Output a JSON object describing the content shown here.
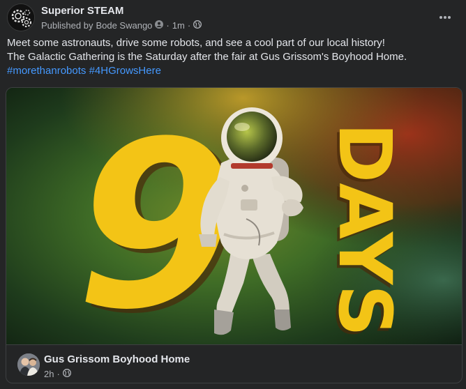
{
  "post": {
    "page_name": "Superior STEAM",
    "published_by_prefix": "Published by",
    "author": "Bode Swango",
    "time": "1m",
    "separator": "·",
    "audience_icon": "globe-icon",
    "more_icon": "more-horizontal-icon",
    "text": {
      "line1": "Meet some astronauts, drive some robots, and see a cool part of our local history!",
      "line2": "The Galactic Gathering is the Saturday after the fair at Gus Grissom's Boyhood Home.",
      "hashtags": [
        "#morethanrobots",
        "#4HGrowsHere"
      ]
    }
  },
  "graphic": {
    "number": "9",
    "word": "DAYS"
  },
  "shared": {
    "page_name": "Gus Grissom Boyhood Home",
    "time": "2h",
    "separator": "·",
    "audience_icon": "globe-icon"
  },
  "colors": {
    "background": "#242526",
    "text": "#e4e6eb",
    "secondary": "#b0b3b8",
    "link": "#4599ff",
    "graphic_yellow": "#f3c416"
  }
}
